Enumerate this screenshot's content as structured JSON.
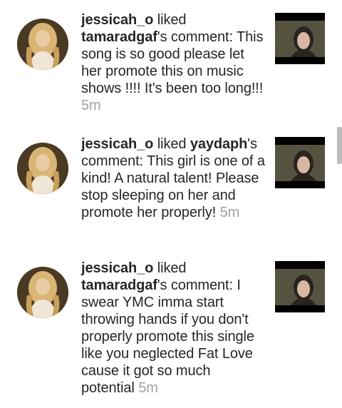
{
  "notifications": [
    {
      "actor": "jessicah_o",
      "action": " liked ",
      "target_user": "tamaradgaf",
      "target_suffix": "'s comment: This song is so good please let her promote this on music shows !!!! It's been too long!!! ",
      "time": "5m"
    },
    {
      "actor": "jessicah_o",
      "action": " liked ",
      "target_user": "yaydaph",
      "target_suffix": "'s comment: This girl is one of a kind! A natural talent! Please stop sleeping on her and promote her properly! ",
      "time": "5m"
    },
    {
      "actor": "jessicah_o",
      "action": " liked ",
      "target_user": "tamaradgaf",
      "target_suffix": "'s comment: I swear YMC imma start throwing hands if you don't properly promote this single like you neglected Fat Love cause it got so much potential ",
      "time": "5m"
    }
  ],
  "icons": {
    "avatar": "profile-photo-blonde-woman",
    "thumbnail": "video-thumbnail-woman"
  },
  "colors": {
    "text": "#262626",
    "timestamp": "#a0a0a0",
    "thumbnail_letterbox": "#000000"
  }
}
